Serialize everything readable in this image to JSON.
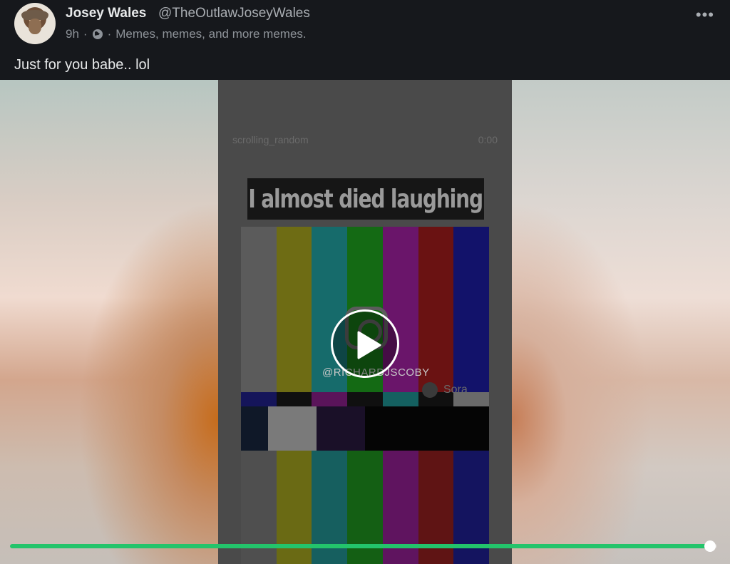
{
  "post": {
    "author_name": "Josey Wales",
    "author_handle": "@TheOutlawJoseyWales",
    "time": "9h",
    "separator": "·",
    "group": "Memes, memes, and more memes.",
    "caption": "Just for you babe.. lol",
    "more_icon": "ellipsis-icon",
    "more_label": "•••"
  },
  "video": {
    "ig_username": "scrolling_random",
    "ig_time": "0:00",
    "overlay_title": "I almost died laughing",
    "watermark_user": "@RICHARDJSCOBY",
    "sora_label": "Sora",
    "play_icon": "play-icon",
    "progress": 0.99,
    "colors": {
      "progress_fill": "#23c46b",
      "bar_colors": [
        "#5b5b5b",
        "#6e6c14",
        "#166b6b",
        "#146a14",
        "#6a156a",
        "#6a1212",
        "#12126a"
      ],
      "row2_colors": [
        "#15155a",
        "#101010",
        "#5a145a",
        "#101010",
        "#146060",
        "#101010",
        "#6a6a6a"
      ],
      "bottom_colors": [
        "#4f4f4f",
        "#6a6a14",
        "#165f5f",
        "#145f14",
        "#5f145f",
        "#5f1414",
        "#14145f"
      ]
    }
  }
}
